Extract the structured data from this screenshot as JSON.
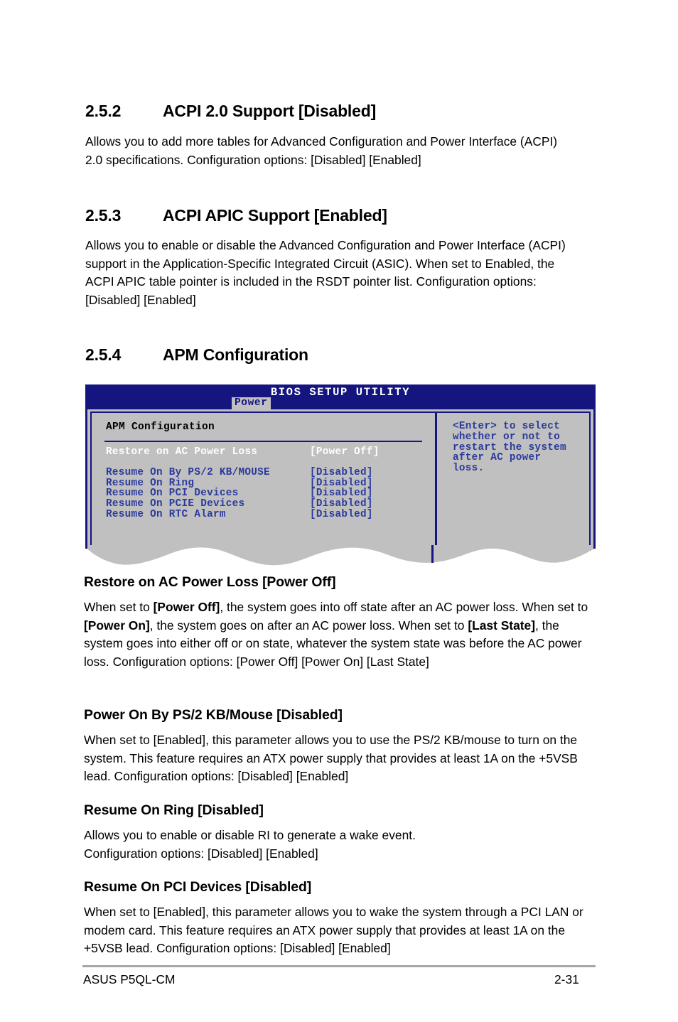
{
  "sections": [
    {
      "number": "2.5.2",
      "title": "ACPI 2.0 Support [Disabled]",
      "body": "Allows you to add more tables for Advanced Configuration and Power Interface (ACPI) 2.0 specifications. Configuration options: [Disabled] [Enabled]"
    },
    {
      "number": "2.5.3",
      "title": "ACPI APIC Support [Enabled]",
      "body": "Allows you to enable or disable the Advanced Configuration and Power Interface (ACPI) support in the Application-Specific Integrated Circuit (ASIC). When set to Enabled, the ACPI APIC table pointer is included in the RSDT pointer list. Configuration options: [Disabled] [Enabled]"
    },
    {
      "number": "2.5.4",
      "title": "APM Configuration"
    }
  ],
  "bios": {
    "title": "BIOS SETUP UTILITY",
    "active_tab": "Power",
    "panel_title": "APM Configuration",
    "rows": [
      {
        "label": "Restore on AC Power Loss",
        "value": "[Power Off]",
        "selected": true
      },
      {
        "label": "Resume On By PS/2 KB/MOUSE",
        "value": "[Disabled]",
        "selected": false
      },
      {
        "label": "Resume On Ring",
        "value": "[Disabled]",
        "selected": false
      },
      {
        "label": "Resume On PCI Devices",
        "value": "[Disabled]",
        "selected": false
      },
      {
        "label": "Resume On PCIE Devices",
        "value": "[Disabled]",
        "selected": false
      },
      {
        "label": "Resume On RTC Alarm",
        "value": "[Disabled]",
        "selected": false
      }
    ],
    "help_text": "<Enter> to select\nwhether or not to\nrestart the system\nafter AC power\nloss.",
    "colors": {
      "titlebar": "#151580",
      "panel": "#c0c0c0",
      "text": "#2b3a9c",
      "selected_text": "#ffffff",
      "tab_bg": "#c0c0c0"
    }
  },
  "subsections": [
    {
      "heading": "Restore on AC Power Loss [Power Off]",
      "paragraph_html": "When set to <b>[Power Off]</b>, the system goes into off state after an AC power loss. When set to <b>[Power On]</b>, the system goes on after an AC power loss. When set to <b>[Last State]</b>, the system goes into either off or on state, whatever the system state was before the AC power loss. Configuration options: [Power Off] [Power On] [Last State]"
    },
    {
      "heading": "Power On By PS/2 KB/Mouse [Disabled]",
      "paragraph_html": "When set to [Enabled], this parameter allows you to use the PS/2 KB/mouse to turn on the system. This feature requires an ATX power supply that provides at least 1A on the +5VSB lead. Configuration options: [Disabled] [Enabled]"
    },
    {
      "heading": "Resume On Ring [Disabled]",
      "paragraph_html": "Allows you to enable or disable RI to generate a wake event.<br>Configuration options: [Disabled] [Enabled]"
    },
    {
      "heading": "Resume On PCI Devices [Disabled]",
      "paragraph_html": "When set to [Enabled], this parameter allows you to wake the system through a PCI LAN or modem card. This feature requires an ATX power supply that provides at least 1A on the +5VSB lead. Configuration options: [Disabled] [Enabled]"
    }
  ],
  "footer": {
    "left": "ASUS P5QL-CM",
    "right": "2-31"
  }
}
